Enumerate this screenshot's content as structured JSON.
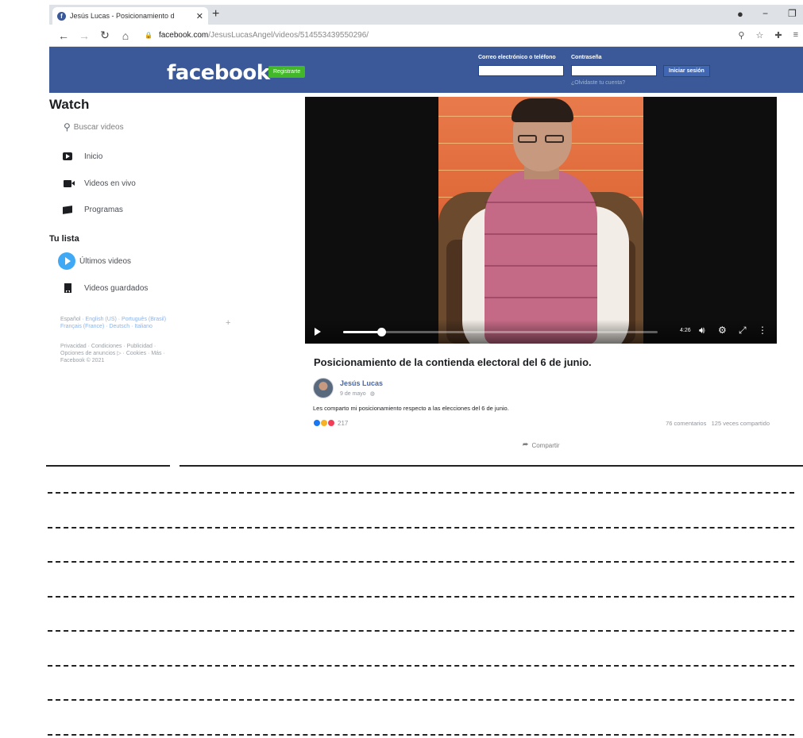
{
  "browser": {
    "tab_title": "Jesús Lucas - Posicionamiento d",
    "tab_close": "✕",
    "new_tab": "+",
    "url_host": "facebook.com",
    "url_path": "/JesusLucasAngel/videos/514553439550296/"
  },
  "header": {
    "logo": "facebook",
    "register_label": "Registrarte",
    "email_label": "Correo electrónico o teléfono",
    "password_label": "Contraseña",
    "login_label": "Iniciar sesión",
    "forgot_label": "¿Olvidaste tu cuenta?",
    "brand_color": "#3b5998"
  },
  "sidebar": {
    "title": "Watch",
    "search_placeholder": "Buscar videos",
    "items": [
      {
        "label": "Inicio",
        "icon": "play-icon"
      },
      {
        "label": "Videos en vivo",
        "icon": "live-camera-icon"
      },
      {
        "label": "Programas",
        "icon": "clapper-icon"
      }
    ],
    "list_title": "Tu lista",
    "list_items": [
      {
        "label": "Últimos videos",
        "icon": "latest-videos-icon"
      },
      {
        "label": "Videos guardados",
        "icon": "bookmark-icon"
      }
    ],
    "languages": {
      "current": "Español",
      "line1": "English (US) · Português (Brasil)",
      "line2": "Français (France) · Deutsch · Italiano"
    },
    "legal": {
      "line1": "Privacidad · Condiciones · Publicidad ·",
      "line2": "Opciones de anuncios ▷ · Cookies · Más ·",
      "line3": "Facebook © 2021"
    }
  },
  "video": {
    "progress": 0.12,
    "time": "4:26"
  },
  "post": {
    "title": "Posicionamiento de la contienda electoral del 6 de junio.",
    "author": "Jesús Lucas",
    "date": "9 de mayo",
    "body": "Les comparto mi posicionamiento respecto a las elecciones del 6 de junio.",
    "reactions_count": "217",
    "comments": "76 comentarios",
    "shares": "125 veces compartido",
    "share_label": "Compartir"
  },
  "worksheet": {
    "dashed_lines": 8
  }
}
